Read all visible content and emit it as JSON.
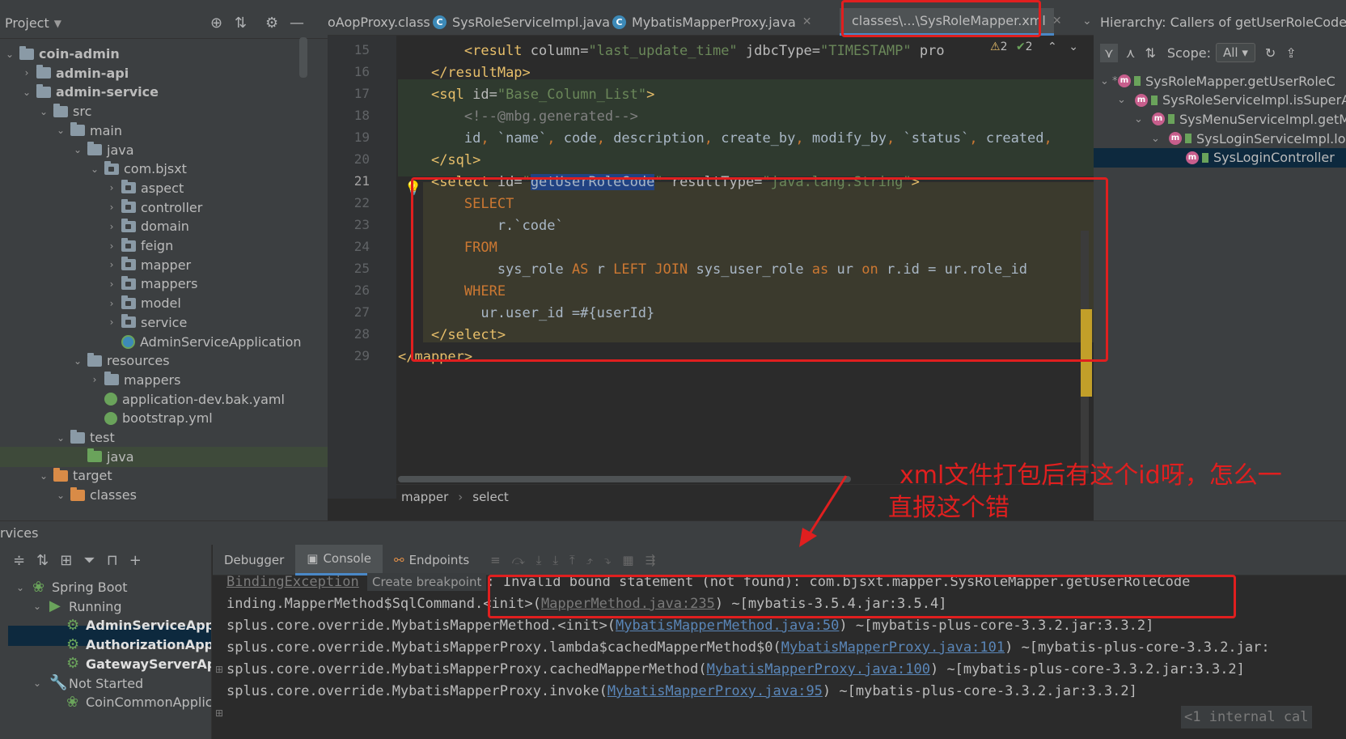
{
  "project_panel": {
    "title": "Project",
    "tree": [
      {
        "label": "coin-admin",
        "depth": 0,
        "arrow": "⌄",
        "bold": true,
        "icon": "module"
      },
      {
        "label": "admin-api",
        "depth": 1,
        "arrow": "›",
        "bold": true,
        "icon": "module"
      },
      {
        "label": "admin-service",
        "depth": 1,
        "arrow": "⌄",
        "bold": true,
        "icon": "module"
      },
      {
        "label": "src",
        "depth": 2,
        "arrow": "⌄",
        "bold": false,
        "icon": "folder"
      },
      {
        "label": "main",
        "depth": 3,
        "arrow": "⌄",
        "bold": false,
        "icon": "folder"
      },
      {
        "label": "java",
        "depth": 4,
        "arrow": "⌄",
        "bold": false,
        "icon": "folder-blue"
      },
      {
        "label": "com.bjsxt",
        "depth": 5,
        "arrow": "⌄",
        "bold": false,
        "icon": "package"
      },
      {
        "label": "aspect",
        "depth": 6,
        "arrow": "›",
        "bold": false,
        "icon": "package"
      },
      {
        "label": "controller",
        "depth": 6,
        "arrow": "›",
        "bold": false,
        "icon": "package"
      },
      {
        "label": "domain",
        "depth": 6,
        "arrow": "›",
        "bold": false,
        "icon": "package"
      },
      {
        "label": "feign",
        "depth": 6,
        "arrow": "›",
        "bold": false,
        "icon": "package"
      },
      {
        "label": "mapper",
        "depth": 6,
        "arrow": "›",
        "bold": false,
        "icon": "package"
      },
      {
        "label": "mappers",
        "depth": 6,
        "arrow": "›",
        "bold": false,
        "icon": "package"
      },
      {
        "label": "model",
        "depth": 6,
        "arrow": "›",
        "bold": false,
        "icon": "package"
      },
      {
        "label": "service",
        "depth": 6,
        "arrow": "›",
        "bold": false,
        "icon": "package"
      },
      {
        "label": "AdminServiceApplication",
        "depth": 6,
        "arrow": "",
        "bold": false,
        "icon": "app"
      },
      {
        "label": "resources",
        "depth": 4,
        "arrow": "⌄",
        "bold": false,
        "icon": "folder-res"
      },
      {
        "label": "mappers",
        "depth": 5,
        "arrow": "›",
        "bold": false,
        "icon": "folder"
      },
      {
        "label": "application-dev.bak.yaml",
        "depth": 5,
        "arrow": "",
        "bold": false,
        "icon": "spring"
      },
      {
        "label": "bootstrap.yml",
        "depth": 5,
        "arrow": "",
        "bold": false,
        "icon": "spring"
      },
      {
        "label": "test",
        "depth": 3,
        "arrow": "⌄",
        "bold": false,
        "icon": "folder"
      },
      {
        "label": "java",
        "depth": 4,
        "arrow": "",
        "bold": false,
        "icon": "folder-green"
      },
      {
        "label": "target",
        "depth": 2,
        "arrow": "⌄",
        "bold": false,
        "icon": "folder-orange"
      },
      {
        "label": "classes",
        "depth": 3,
        "arrow": "⌄",
        "bold": false,
        "icon": "folder-orange"
      }
    ]
  },
  "tabs": [
    {
      "label": "oAopProxy.class",
      "icon": "none"
    },
    {
      "label": "SysRoleServiceImpl.java",
      "icon": "class"
    },
    {
      "label": "MybatisMapperProxy.java",
      "icon": "class"
    },
    {
      "label": "classes\\...\\SysRoleMapper.xml",
      "icon": "xml",
      "active": true
    }
  ],
  "inspection": {
    "warnings": "2",
    "ok": "2"
  },
  "editor": {
    "line_numbers": [
      "15",
      "16",
      "17",
      "18",
      "19",
      "20",
      "21",
      "22",
      "23",
      "24",
      "25",
      "26",
      "27",
      "28",
      "29"
    ],
    "current_line": "21",
    "breadcrumb": [
      "mapper",
      "select"
    ]
  },
  "hierarchy": {
    "title": "Hierarchy: Callers of getUserRoleCode",
    "scope_label": "Scope:",
    "scope_value": "All",
    "items": [
      {
        "label": "SysRoleMapper.getUserRoleC",
        "depth": 0,
        "prefix": "⌄ *"
      },
      {
        "label": "SysRoleServiceImpl.isSuperA",
        "depth": 1,
        "prefix": "⌄"
      },
      {
        "label": "SysMenuServiceImpl.getM",
        "depth": 2,
        "prefix": "⌄"
      },
      {
        "label": "SysLoginServiceImpl.lo",
        "depth": 3,
        "prefix": "⌄"
      },
      {
        "label": "SysLoginController",
        "depth": 4,
        "prefix": ""
      }
    ]
  },
  "services": {
    "title": "rvices",
    "tree": [
      {
        "label": "Spring Boot",
        "depth": 0,
        "arrow": "⌄",
        "icon": "spring",
        "bold": false
      },
      {
        "label": "Running",
        "depth": 1,
        "arrow": "⌄",
        "icon": "run",
        "bold": false
      },
      {
        "label": "AdminServiceApplica",
        "depth": 2,
        "arrow": "",
        "icon": "gear",
        "bold": true
      },
      {
        "label": "AuthorizationApplica",
        "depth": 2,
        "arrow": "",
        "icon": "gear",
        "bold": true
      },
      {
        "label": "GatewayServerAppli",
        "depth": 2,
        "arrow": "",
        "icon": "gear",
        "bold": true
      },
      {
        "label": "Not Started",
        "depth": 1,
        "arrow": "⌄",
        "icon": "wrench",
        "bold": false
      },
      {
        "label": "CoinCommonApplica",
        "depth": 2,
        "arrow": "",
        "icon": "spring",
        "bold": false
      }
    ],
    "console_tabs": [
      "Debugger",
      "Console",
      "Endpoints"
    ]
  },
  "console": {
    "exception_link": "BindingException",
    "create_breakpoint": "Create breakpoint",
    "error_message": ": Invalid bound statement (not found): com.bjsxt.mapper.SysRoleMapper.getUserRoleCode",
    "lines": [
      {
        "pre": "inding.MapperMethod$SqlCommand.<init>(",
        "link": "MapperMethod.java:235",
        "post": ") ~[mybatis-3.5.4.jar:3.5.4]"
      },
      {
        "pre": "splus.core.override.MybatisMapperMethod.<init>(",
        "link": "MybatisMapperMethod.java:50",
        "post": ") ~[mybatis-plus-core-3.3.2.jar:3.3.2]"
      },
      {
        "pre": "splus.core.override.MybatisMapperProxy.lambda$cachedMapperMethod$0(",
        "link": "MybatisMapperProxy.java:101",
        "post": ") ~[mybatis-plus-core-3.3.2.jar:"
      },
      {
        "pre": "splus.core.override.MybatisMapperProxy.cachedMapperMethod(",
        "link": "MybatisMapperProxy.java:100",
        "post": ") ~[mybatis-plus-core-3.3.2.jar:3.3.2]"
      },
      {
        "pre": "splus.core.override.MybatisMapperProxy.invoke(",
        "link": "MybatisMapperProxy.java:95",
        "post": ") ~[mybatis-plus-core-3.3.2.jar:3.3.2]"
      }
    ],
    "internal_calls": "<1 internal cal"
  },
  "annotation": {
    "line1": "xml文件打包后有这个id呀，怎么一",
    "line2": "直报这个错"
  },
  "colors": {
    "accent": "#4a88c7",
    "annotation_red": "#e01f1f",
    "xml_tag": "#e8bf6a",
    "xml_string": "#6a8759",
    "sql_keyword": "#cc7832"
  }
}
